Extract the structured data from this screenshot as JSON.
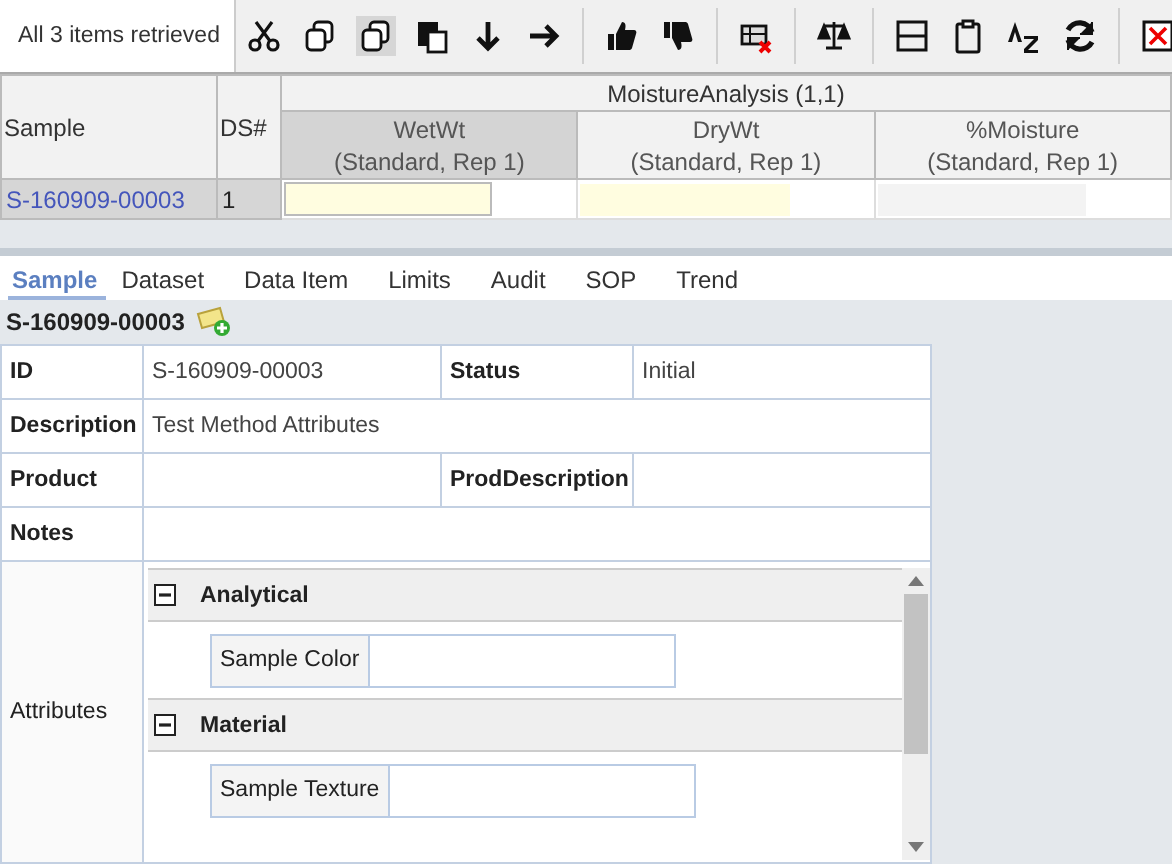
{
  "toolbar": {
    "status": "All 3 items retrieved"
  },
  "grid": {
    "columns": [
      "Sample",
      "DS#"
    ],
    "group_header": "MoistureAnalysis (1,1)",
    "analysis_columns": [
      {
        "name": "WetWt",
        "sub": "(Standard, Rep 1)",
        "selected": true
      },
      {
        "name": "DryWt",
        "sub": "(Standard, Rep 1)",
        "selected": false
      },
      {
        "name": "%Moisture",
        "sub": "(Standard, Rep 1)",
        "selected": false
      }
    ],
    "rows": [
      {
        "sample": "S-160909-00003",
        "ds": "1",
        "cells": [
          {
            "kind": "focused"
          },
          {
            "kind": "editable"
          },
          {
            "kind": "readonly"
          }
        ]
      }
    ]
  },
  "tabs": [
    {
      "label": "Sample",
      "selected": true
    },
    {
      "label": "Dataset",
      "selected": false
    },
    {
      "label": "Data Item",
      "selected": false
    },
    {
      "label": "Limits",
      "selected": false
    },
    {
      "label": "Audit",
      "selected": false
    },
    {
      "label": "SOP",
      "selected": false
    },
    {
      "label": "Trend",
      "selected": false
    }
  ],
  "record": {
    "title": "S-160909-00003",
    "rows": [
      {
        "kind": "pair",
        "label": "ID",
        "value": "S-160909-00003",
        "label2": "Status",
        "value2": "Initial"
      },
      {
        "kind": "wide",
        "label": "Description",
        "value": "Test Method Attributes"
      },
      {
        "kind": "pair",
        "label": "Product",
        "label2": "ProdDescription"
      },
      {
        "kind": "wide",
        "label": "Notes"
      }
    ],
    "attributes": {
      "label": "Attributes",
      "groups": [
        {
          "name": "Analytical",
          "expanded": true,
          "fields": [
            {
              "label": "Sample Color"
            }
          ]
        },
        {
          "name": "Material",
          "expanded": true,
          "fields": [
            {
              "label": "Sample Texture"
            }
          ]
        }
      ]
    }
  }
}
